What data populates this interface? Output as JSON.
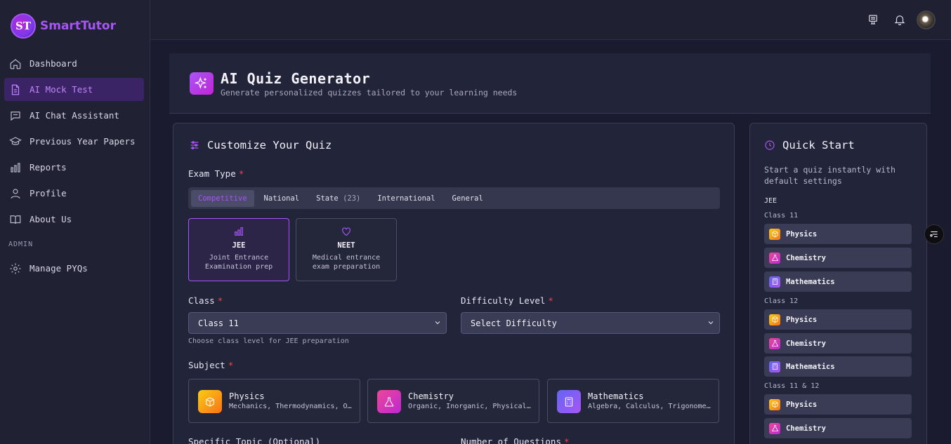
{
  "brand": {
    "logo_text": "ST",
    "name": "SmartTutor"
  },
  "sidebar": {
    "items": [
      {
        "label": "Dashboard",
        "icon": "home-icon"
      },
      {
        "label": "AI Mock Test",
        "icon": "document-icon",
        "active": true
      },
      {
        "label": "AI Chat Assistant",
        "icon": "chat-icon"
      },
      {
        "label": "Previous Year Papers",
        "icon": "graduation-cap-icon"
      },
      {
        "label": "Reports",
        "icon": "bar-chart-icon"
      },
      {
        "label": "Profile",
        "icon": "user-icon"
      },
      {
        "label": "About Us",
        "icon": "book-icon"
      }
    ],
    "admin_label": "ADMIN",
    "admin_items": [
      {
        "label": "Manage PYQs",
        "icon": "gear-icon"
      }
    ]
  },
  "header": {
    "title": "AI Quiz Generator",
    "subtitle": "Generate personalized quizzes tailored to your learning needs"
  },
  "customize": {
    "title": "Customize Your Quiz",
    "exam_type_label": "Exam Type",
    "tabs": [
      {
        "label": "Competitive",
        "count": ""
      },
      {
        "label": "National",
        "count": ""
      },
      {
        "label": "State",
        "count": "(23)"
      },
      {
        "label": "International",
        "count": ""
      },
      {
        "label": "General",
        "count": ""
      }
    ],
    "exams": [
      {
        "name": "JEE",
        "desc": "Joint Entrance Examination prep",
        "selected": true
      },
      {
        "name": "NEET",
        "desc": "Medical entrance exam preparation",
        "selected": false
      }
    ],
    "class_label": "Class",
    "class_value": "Class 11",
    "class_hint": "Choose class level for JEE preparation",
    "difficulty_label": "Difficulty Level",
    "difficulty_value": "Select Difficulty",
    "subject_label": "Subject",
    "subjects": [
      {
        "name": "Physics",
        "desc": "Mechanics, Thermodynamics, Optics"
      },
      {
        "name": "Chemistry",
        "desc": "Organic, Inorganic, Physical Chemistry"
      },
      {
        "name": "Mathematics",
        "desc": "Algebra, Calculus, Trigonometry"
      }
    ],
    "topic_label": "Specific Topic (Optional)",
    "questions_label": "Number of Questions"
  },
  "quick_start": {
    "title": "Quick Start",
    "desc": "Start a quiz instantly with default settings",
    "group": "JEE",
    "classes": [
      {
        "label": "Class 11",
        "subjects": [
          "Physics",
          "Chemistry",
          "Mathematics"
        ]
      },
      {
        "label": "Class 12",
        "subjects": [
          "Physics",
          "Chemistry",
          "Mathematics"
        ]
      },
      {
        "label": "Class 11 & 12",
        "subjects": [
          "Physics",
          "Chemistry"
        ]
      }
    ]
  },
  "required_mark": "*"
}
